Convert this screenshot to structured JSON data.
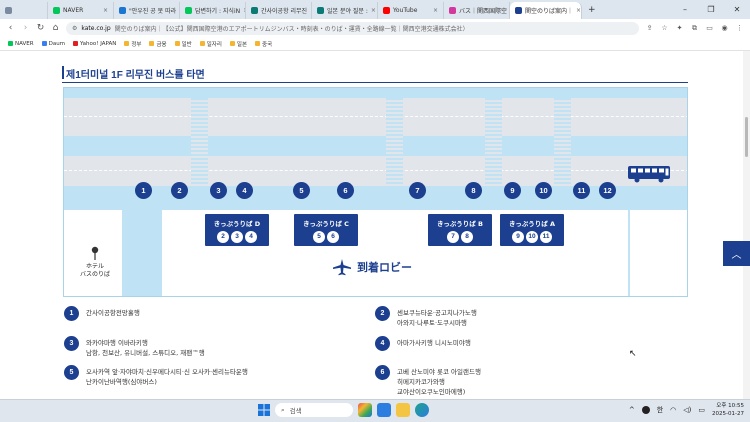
{
  "browser": {
    "tabs": [
      {
        "label": "",
        "color": "#7a8aa0",
        "width": 48
      },
      {
        "label": "NAVER",
        "color": "#03c75a",
        "width": 66
      },
      {
        "label": "\"안우진 공 못 따라",
        "color": "#1976d2",
        "width": 66
      },
      {
        "label": "답변하기 : 지식iN",
        "color": "#03c75a",
        "width": 66
      },
      {
        "label": "간사이공항 리무진",
        "color": "#0b7a75",
        "width": 66
      },
      {
        "label": "일본 분야 질문 :",
        "color": "#0b7a75",
        "width": 66
      },
      {
        "label": "YouTube",
        "color": "#ff0000",
        "width": 66
      },
      {
        "label": "バス｜関西国際空",
        "color": "#d3389e",
        "width": 66
      },
      {
        "label": "関空のりば案内｜",
        "color": "#1c3f8f",
        "width": 72,
        "active": true
      }
    ],
    "new_tab": "+",
    "window_controls": {
      "minimize": "–",
      "maximize": "❐",
      "close": "✕"
    },
    "url_host": "kate.co.jp",
    "url_rest": "関空のりば案内｜【公式】関西国際空港のエアポートリムジンバス・時刻表・のりば・運賃・全路線一覧｜関西空港交通株式会社）",
    "bookmarks": [
      {
        "label": "NAVER",
        "color": "#03c75a"
      },
      {
        "label": "Daum",
        "color": "#3c7ef0"
      },
      {
        "label": "Yahoo! JAPAN",
        "color": "#e02020"
      },
      {
        "label": "정부",
        "color": "#f2b632"
      },
      {
        "label": "금융",
        "color": "#f2b632"
      },
      {
        "label": "일반",
        "color": "#f2b632"
      },
      {
        "label": "일자리",
        "color": "#f2b632"
      },
      {
        "label": "일본",
        "color": "#f2b632"
      },
      {
        "label": "중국",
        "color": "#f2b632"
      }
    ]
  },
  "page": {
    "section_title": "제1터미널 1F 리무진 버스를 타면",
    "accent_color": "#1c3f8f",
    "stops": [
      "1",
      "2",
      "3",
      "4",
      "5",
      "6",
      "7",
      "8",
      "9",
      "10",
      "11",
      "12"
    ],
    "booths": [
      {
        "label": "きっぷうりば D",
        "nums": [
          "2",
          "3",
          "4"
        ]
      },
      {
        "label": "きっぷうりば C",
        "nums": [
          "5",
          "6"
        ]
      },
      {
        "label": "きっぷうりば B",
        "nums": [
          "7",
          "8"
        ]
      },
      {
        "label": "きっぷうりば A",
        "nums": [
          "9",
          "10",
          "11"
        ]
      }
    ],
    "arrivals_lobby": "到着ロビー",
    "hotel_line1": "ホテル",
    "hotel_line2": "バスのりば",
    "legend": [
      {
        "num": "1",
        "text": "간사이공항전망홀행"
      },
      {
        "num": "2",
        "text": "센보쿠뉴타운·공고치나가노행\n아와지·나루토·도쿠시마행"
      },
      {
        "num": "3",
        "text": "와카야마행 이바라키행\n남항, 천보산, 유니버설, 스튜디오, 재팬™행"
      },
      {
        "num": "4",
        "text": "아마가사키행 니시노미야행"
      },
      {
        "num": "5",
        "text": "오사카역 앞·자야마치·신우메다시티·신 오사카·센리뉴타운행\n난카이난바역행(심야버스)"
      },
      {
        "num": "6",
        "text": "고베 산노미야 롯코 아일랜드행\n히메지카코가와행\n교야산이오쿠노인마에행)"
      }
    ]
  },
  "taskbar": {
    "search_placeholder": "검색",
    "lang": "한",
    "time": "오후 10:55",
    "date": "2025-01-27"
  }
}
